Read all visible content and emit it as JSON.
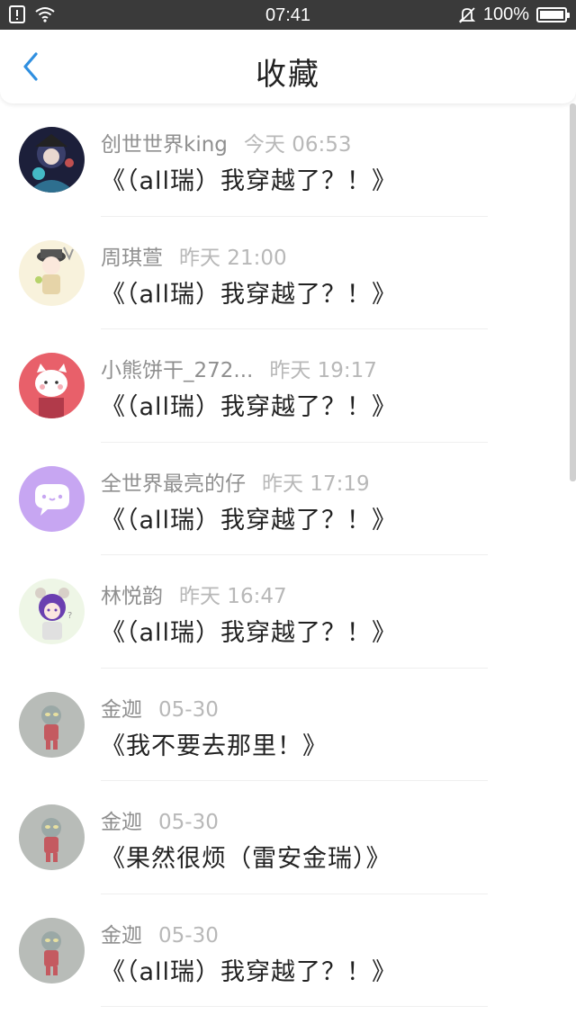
{
  "status_bar": {
    "time": "07:41",
    "battery": "100%"
  },
  "header": {
    "title": "收藏"
  },
  "items": [
    {
      "user": "创世世界king",
      "time": "今天 06:53",
      "title": "《（all瑞）我穿越了？！》",
      "avatar": "avatar-dark-character"
    },
    {
      "user": "周琪萱",
      "time": "昨天 21:00",
      "title": "《（all瑞）我穿越了？！》",
      "avatar": "avatar-chibi-character"
    },
    {
      "user": "小熊饼干_272...",
      "time": "昨天 19:17",
      "title": "《（all瑞）我穿越了？！》",
      "avatar": "avatar-pink-cat"
    },
    {
      "user": "全世界最亮的仔",
      "time": "昨天 17:19",
      "title": "《（all瑞）我穿越了？！》",
      "avatar": "avatar-chat-bubble"
    },
    {
      "user": "林悦韵",
      "time": "昨天 16:47",
      "title": "《（all瑞）我穿越了？！》",
      "avatar": "avatar-purple-hair-character"
    },
    {
      "user": "金迦",
      "time": "05-30",
      "title": "《我不要去那里！》",
      "avatar": "avatar-grey-figure"
    },
    {
      "user": "金迦",
      "time": "05-30",
      "title": "《果然很烦（雷安金瑞）》",
      "avatar": "avatar-grey-figure"
    },
    {
      "user": "金迦",
      "time": "05-30",
      "title": "《（all瑞）我穿越了？！》",
      "avatar": "avatar-grey-figure"
    }
  ],
  "colors": {
    "accent": "#2f8fe0",
    "status_bar": "#3a3a3a",
    "chat_bubble": "#c7a6f2"
  }
}
